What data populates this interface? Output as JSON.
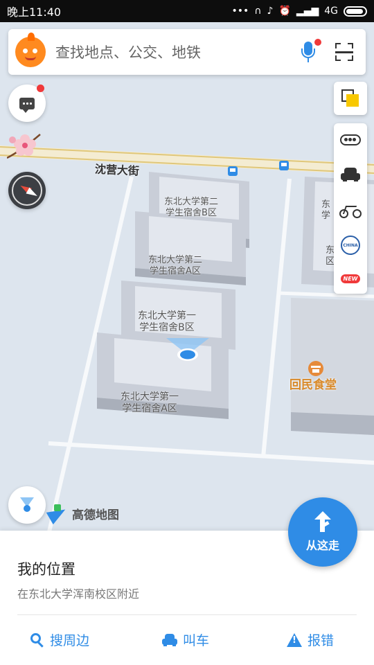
{
  "status_bar": {
    "time": "晚上11:40",
    "network": "4G"
  },
  "search": {
    "placeholder": "查找地点、公交、地铁"
  },
  "map": {
    "street_name": "沈营大街",
    "buildings": [
      {
        "line1": "东北大学第二",
        "line2": "学生宿舍B区"
      },
      {
        "line1": "东北大学第二",
        "line2": "学生宿舍A区"
      },
      {
        "line1": "东北大学第一",
        "line2": "学生宿舍B区"
      },
      {
        "line1": "东北大学第一",
        "line2": "学生宿舍A区"
      }
    ],
    "partial_labels": [
      "东",
      "学",
      "东",
      "区"
    ],
    "poi_name": "回民食堂",
    "logo_text": "高德地图",
    "colors": {
      "accent": "#2f8ce6",
      "poi_orange": "#d98a2a",
      "map_bg": "#dde5ee"
    }
  },
  "side_toolbar": {
    "items": [
      "traffic-icon",
      "taxi-icon",
      "bike-icon",
      "metro-icon",
      "new-badge"
    ],
    "metro_label": "CHINA",
    "new_label": "NEW"
  },
  "go_button": {
    "label": "从这走"
  },
  "bottom_card": {
    "title": "我的位置",
    "subtitle": "在东北大学浑南校区附近",
    "actions": [
      {
        "icon": "search-icon",
        "label": "搜周边"
      },
      {
        "icon": "car-icon",
        "label": "叫车"
      },
      {
        "icon": "warning-icon",
        "label": "报错"
      }
    ]
  }
}
